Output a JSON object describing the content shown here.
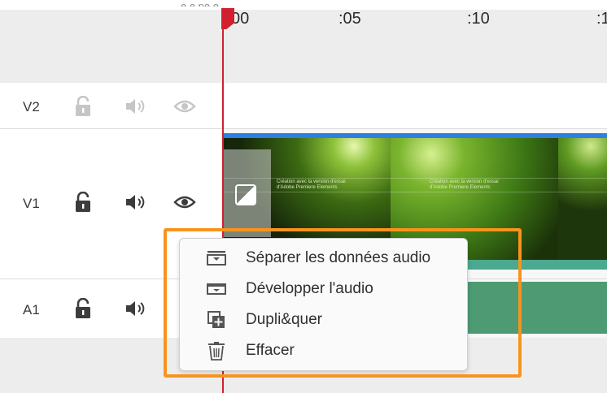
{
  "timeline": {
    "ticks": [
      "00",
      ":05",
      ":10",
      ":1"
    ],
    "clipped_top_text": "e e pe e e"
  },
  "tracks": [
    {
      "label": "V2",
      "lock_icon": "lock-open-icon",
      "audio_icon": "speaker-icon",
      "eye_icon": "eye-icon"
    },
    {
      "label": "V1",
      "lock_icon": "lock-open-icon",
      "audio_icon": "speaker-icon",
      "eye_icon": "eye-icon"
    },
    {
      "label": "A1",
      "lock_icon": "lock-open-icon",
      "audio_icon": "speaker-icon"
    }
  ],
  "clip": {
    "thumbnail_caption_1": "Création avec la version d'essai",
    "thumbnail_caption_2": "d'Adobe Premiere Elements",
    "colors": {
      "clip_bar": "#2f7fe0",
      "audio": "#4d9a73",
      "waveform": "#4aa98e"
    }
  },
  "context_menu": {
    "items": [
      {
        "label": "Séparer les données audio",
        "icon": "split-audio-icon"
      },
      {
        "label": "Développer l'audio",
        "icon": "expand-audio-icon"
      },
      {
        "label": "Dupli&quer",
        "icon": "duplicate-icon"
      },
      {
        "label": "Effacer",
        "icon": "trash-icon"
      }
    ]
  },
  "colors": {
    "playhead": "#d2202f",
    "highlight": "#f7931e"
  }
}
